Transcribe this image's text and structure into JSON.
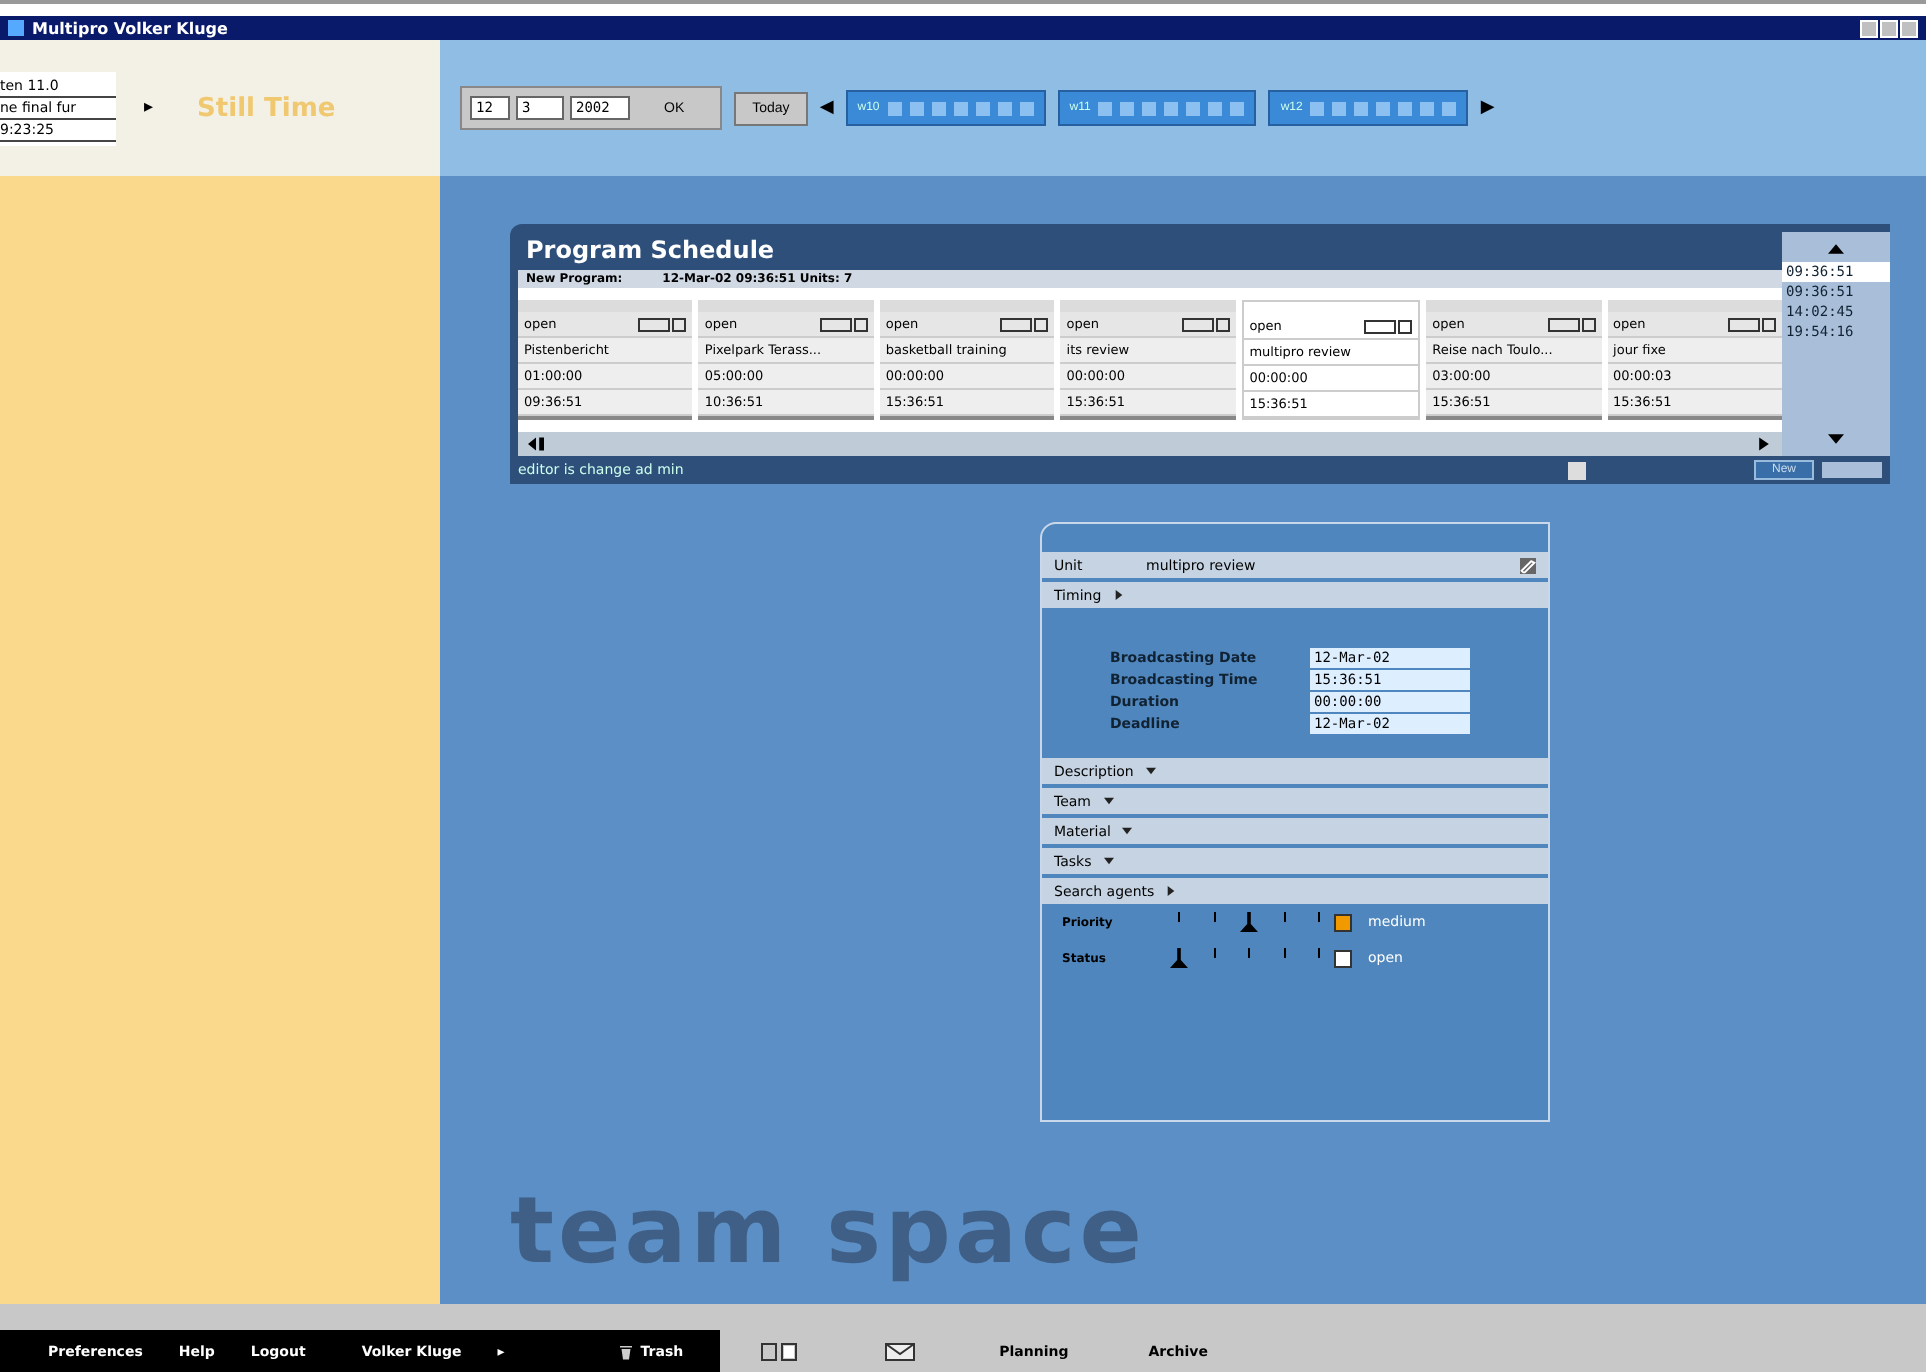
{
  "window": {
    "title": "Multipro Volker Kluge"
  },
  "ticker": {
    "lines": [
      "ten 11.0",
      "ne final fur",
      "9:23:25"
    ],
    "arrow": "▸",
    "label": "Still Time"
  },
  "date_bar": {
    "day": "12",
    "month": "3",
    "year": "2002",
    "ok": "OK",
    "today": "Today",
    "prev": "◀",
    "next": "▶",
    "weeks": [
      {
        "label": "w10",
        "selected": false
      },
      {
        "label": "w11",
        "selected": false
      },
      {
        "label": "w12",
        "selected": false
      }
    ]
  },
  "schedule": {
    "title": "Program Schedule",
    "info_label": "New Program:",
    "info": "12-Mar-02 09:36:51 Units: 7",
    "programs": [
      {
        "status": "open",
        "name": "Pistenbericht",
        "duration": "01:00:00",
        "time": "09:36:51",
        "selected": false
      },
      {
        "status": "open",
        "name": "Pixelpark Terass...",
        "duration": "05:00:00",
        "time": "10:36:51",
        "selected": false
      },
      {
        "status": "open",
        "name": "basketball training",
        "duration": "00:00:00",
        "time": "15:36:51",
        "selected": false
      },
      {
        "status": "open",
        "name": "its review",
        "duration": "00:00:00",
        "time": "15:36:51",
        "selected": false
      },
      {
        "status": "open",
        "name": "multipro review",
        "duration": "00:00:00",
        "time": "15:36:51",
        "selected": true
      },
      {
        "status": "open",
        "name": "Reise nach Toulo...",
        "duration": "03:00:00",
        "time": "15:36:51",
        "selected": false
      },
      {
        "status": "open",
        "name": "jour fixe",
        "duration": "00:00:03",
        "time": "15:36:51",
        "selected": false
      }
    ],
    "times": [
      {
        "label": "09:36:51",
        "selected": true
      },
      {
        "label": "09:36:51",
        "selected": false
      },
      {
        "label": "14:02:45",
        "selected": false
      },
      {
        "label": "19:54:16",
        "selected": false
      }
    ],
    "footer": "editor is change ad min",
    "new_button": "New"
  },
  "unit": {
    "label": "Unit",
    "name": "multipro review",
    "sections": [
      {
        "label": "Timing",
        "expanded": true
      },
      {
        "label": "Description",
        "expanded": false
      },
      {
        "label": "Team",
        "expanded": false
      },
      {
        "label": "Material",
        "expanded": false
      },
      {
        "label": "Tasks",
        "expanded": false
      },
      {
        "label": "Search agents",
        "expanded": true
      }
    ],
    "timing": [
      {
        "label": "Broadcasting Date",
        "value": "12-Mar-02"
      },
      {
        "label": "Broadcasting Time",
        "value": "15:36:51"
      },
      {
        "label": "Duration",
        "value": "00:00:00"
      },
      {
        "label": "Deadline",
        "value": "12-Mar-02"
      }
    ],
    "sliders": [
      {
        "label": "Priority",
        "level": 0.5,
        "value": "medium",
        "color": "#f09a00"
      },
      {
        "label": "Status",
        "level": 0,
        "value": "open",
        "color": "#ffffff"
      }
    ]
  },
  "brand": "team space",
  "taskbar": {
    "items": [
      "Preferences",
      "Help",
      "Logout"
    ],
    "user": "Volker Kluge",
    "arrow": "▸",
    "trash": "Trash",
    "tabs": [
      "Planning",
      "Archive"
    ]
  }
}
